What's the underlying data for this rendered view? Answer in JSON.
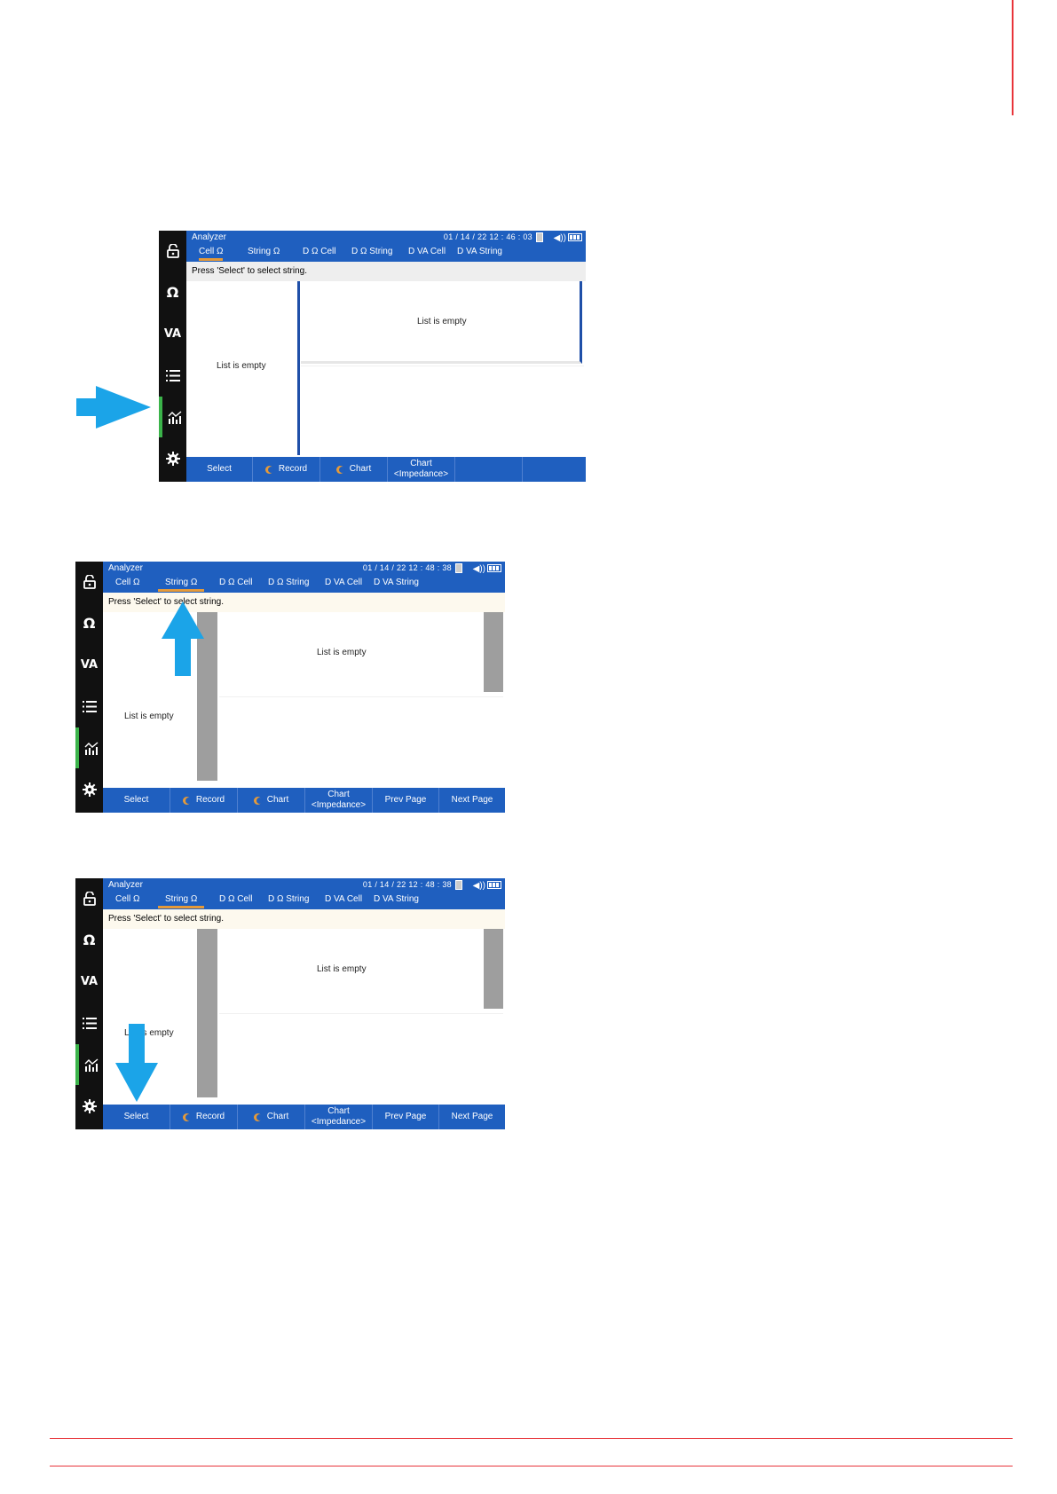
{
  "screens": [
    {
      "title": "Analyzer",
      "datetime": "01 / 14 / 22   12 : 46 : 03",
      "tabs": [
        "Cell Ω",
        "String Ω",
        "D Ω Cell",
        "D Ω String",
        "D VA Cell",
        "D VA String"
      ],
      "active_tab": 0,
      "hint": "Press 'Select' to select string.",
      "left_empty": "List is empty",
      "right_empty": "List is empty",
      "buttons": [
        "Select",
        "Record",
        "Chart",
        "Chart\n<Impedance>",
        "",
        ""
      ]
    },
    {
      "title": "Analyzer",
      "datetime": "01 / 14 / 22   12 : 48 : 38",
      "tabs": [
        "Cell Ω",
        "String Ω",
        "D Ω Cell",
        "D Ω String",
        "D VA Cell",
        "D VA String"
      ],
      "active_tab": 1,
      "hint": "Press 'Select' to select string.",
      "left_empty": "List is empty",
      "right_empty": "List is empty",
      "buttons": [
        "Select",
        "Record",
        "Chart",
        "Chart\n<Impedance>",
        "Prev Page",
        "Next Page"
      ]
    },
    {
      "title": "Analyzer",
      "datetime": "01 / 14 / 22   12 : 48 : 38",
      "tabs": [
        "Cell Ω",
        "String Ω",
        "D Ω Cell",
        "D Ω String",
        "D VA Cell",
        "D VA String"
      ],
      "active_tab": 1,
      "hint": "Press 'Select' to select string.",
      "left_empty": "List is empty",
      "right_empty": "List is empty",
      "buttons": [
        "Select",
        "Record",
        "Chart",
        "Chart\n<Impedance>",
        "Prev Page",
        "Next Page"
      ]
    }
  ],
  "sidebar": {
    "ohm_label": "Ω",
    "va_label": "VA",
    "icons": [
      "lock-icon",
      "ohm-icon",
      "va-icon",
      "list-icon",
      "chart-icon",
      "gear-icon"
    ]
  },
  "colors": {
    "bar_blue": "#1f5fbf",
    "accent_orange": "#e59a3a",
    "arrow_blue": "#1ba4e8",
    "rule_red": "#e8343a",
    "active_green": "#3bb34a"
  }
}
